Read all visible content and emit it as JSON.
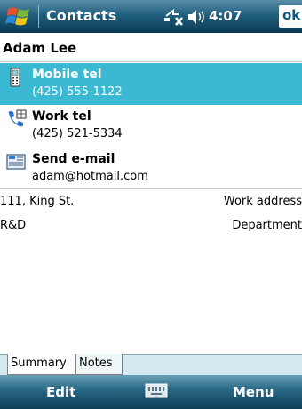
{
  "titlebar": {
    "app_title": "Contacts",
    "time": "4:07",
    "ok_label": "ok",
    "icons": [
      "windows-start-icon",
      "connectivity-icon",
      "volume-icon"
    ]
  },
  "contact": {
    "name": "Adam Lee",
    "fields": [
      {
        "label": "Mobile tel",
        "value": "(425) 555-1122",
        "icon": "mobile-phone-icon",
        "selected": true
      },
      {
        "label": "Work tel",
        "value": "(425) 521-5334",
        "icon": "work-phone-icon",
        "selected": false
      },
      {
        "label": "Send e-mail",
        "value": "adam@hotmail.com",
        "icon": "email-icon",
        "selected": false
      }
    ],
    "info": [
      {
        "value": "111, King St.",
        "label": "Work address"
      },
      {
        "value": "R&D",
        "label": "Department"
      }
    ]
  },
  "tabs": [
    {
      "label": "Summary",
      "active": true
    },
    {
      "label": "Notes",
      "active": false
    }
  ],
  "menubar": {
    "left_soft_key": "Edit",
    "right_soft_key": "Menu",
    "center_icon": "keyboard-icon"
  },
  "colors": {
    "accent": "#3cb9d2",
    "titlebar": "#1f5f7e",
    "tabbar": "#d4eaf0"
  }
}
